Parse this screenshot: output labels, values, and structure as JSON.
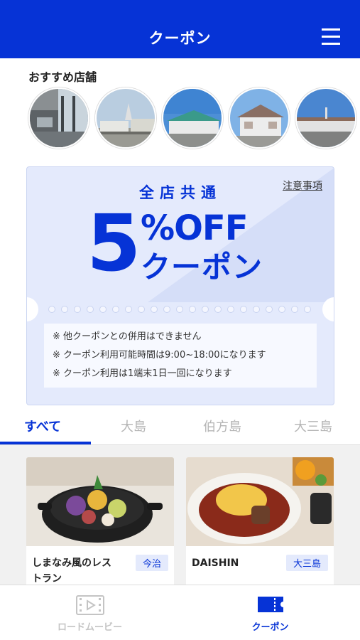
{
  "header": {
    "title": "クーポン",
    "menu_icon": "hamburger-menu-icon"
  },
  "recommended": {
    "title": "おすすめ店舗",
    "stores": [
      {
        "icon": "store-photo-1"
      },
      {
        "icon": "store-photo-2"
      },
      {
        "icon": "store-photo-3"
      },
      {
        "icon": "store-photo-4"
      },
      {
        "icon": "store-photo-5"
      }
    ]
  },
  "coupon": {
    "subtitle": "全店共通",
    "notice_link": "注意事項",
    "big_number": "5",
    "percent_off": "%OFF",
    "coupon_word": "クーポン",
    "notes": [
      "※ 他クーポンとの併用はできません",
      "※ クーポン利用可能時間は9:00~18:00になります",
      "※ クーポン利用は1端末1日一回になります"
    ]
  },
  "tabs": [
    {
      "label": "すべて",
      "active": true
    },
    {
      "label": "大島",
      "active": false
    },
    {
      "label": "伯方島",
      "active": false
    },
    {
      "label": "大三島",
      "active": false
    }
  ],
  "cards": [
    {
      "name": "しまなみ風のレストラン",
      "tag": "今治"
    },
    {
      "name": "DAISHIN",
      "tag": "大三島"
    }
  ],
  "bottom_nav": [
    {
      "label": "ロードムービー",
      "icon": "film-icon",
      "active": false
    },
    {
      "label": "クーポン",
      "icon": "ticket-icon",
      "active": true
    }
  ],
  "colors": {
    "primary": "#0633d6",
    "coupon_bg": "#e4eafc"
  }
}
